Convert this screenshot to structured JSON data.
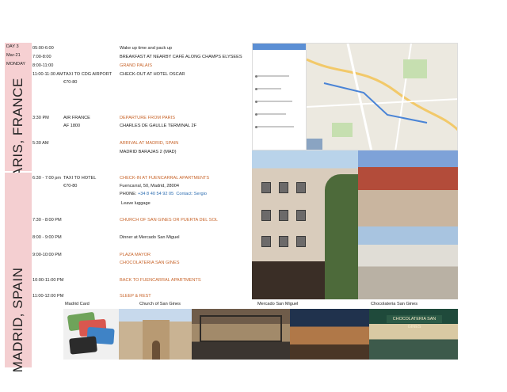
{
  "sections": {
    "paris": "PARIS, FRANCE",
    "madrid": "MADRID, SPAIN"
  },
  "day": {
    "label": "DAY 3",
    "date": "Mar-21",
    "weekday": "MONDAY"
  },
  "itinerary": [
    {
      "time": "05:00-6:00",
      "transport": "",
      "activity": "Wake up time and pack up",
      "style": ""
    },
    {
      "time": "7:00-8:00",
      "transport": "",
      "activity": "BREAKFAST AT NEARBY CAFÉ ALONG CHAMPS ELYSEES",
      "style": ""
    },
    {
      "time": "8:00-11:00",
      "transport": "",
      "activity": "GRAND PALAIS",
      "style": "orange"
    },
    {
      "time": "11:00-11:30 AM",
      "transport": "TAXI TO CDG AIRPORT",
      "activity": "CHECK-OUT AT HOTEL OSCAR",
      "style": ""
    },
    {
      "time": "",
      "transport": "€70-80",
      "activity": "",
      "style": ""
    },
    {
      "time": "3:30 PM",
      "transport": "AIR FRANCE",
      "activity": "DEPARTURE FROM PARIS",
      "style": "orange"
    },
    {
      "time": "",
      "transport": "AF 1800",
      "activity": "CHARLES DE GAULLE TERMINAL 2F",
      "style": ""
    },
    {
      "time": "5:30 AM",
      "transport": "",
      "activity": "ARRIVAL AT MADRID, SPAIN",
      "style": "orange"
    },
    {
      "time": "",
      "transport": "",
      "activity": "MADRID BARAJAS 2  (MAD)",
      "style": ""
    },
    {
      "time": "6:30 - 7:00 pm",
      "transport": "TAXI TO HOTEL",
      "activity": "CHECK-IN AT FUENCARRAL APARTMENTS",
      "style": "orange"
    },
    {
      "time": "",
      "transport": "€70-80",
      "activity": "Fuencarral, 50, Madrid, 28004",
      "style": ""
    },
    {
      "time": "",
      "transport": "",
      "activity": "PHONE: ",
      "style": ""
    },
    {
      "time": "",
      "transport": "",
      "activity": "Leave luggage",
      "style": ""
    },
    {
      "time": "7:30 - 8:00 PM",
      "transport": "",
      "activity": "CHURCH OF SAN GINES OR PUERTA DEL SOL",
      "style": "orange"
    },
    {
      "time": "8:00 - 9:00 PM",
      "transport": "",
      "activity": "Dinner at Mercado San Miguel",
      "style": ""
    },
    {
      "time": "9:00-10:00 PM",
      "transport": "",
      "activity": "PLAZA MAYOR",
      "style": "orange"
    },
    {
      "time": "",
      "transport": "",
      "activity": "CHOCOLATERIA  SAN GINES",
      "style": "orange"
    },
    {
      "time": "10:00-11:00 PM",
      "transport": "",
      "activity": "BACK TO FUENCARRAL APARTMENTS",
      "style": "orange"
    },
    {
      "time": "11:00-12:00 PM",
      "transport": "",
      "activity": "SLEEP & REST",
      "style": "orange"
    }
  ],
  "phone": {
    "number": "+34 8 40 54 92 05",
    "contact": "Contact: Sergio"
  },
  "captions": {
    "madrid_card": "Madrid Card",
    "church": "Church of San Gines",
    "mercado": "Mercado San Miguel",
    "chocolateria": "Chocolateria San Gines"
  },
  "signs": {
    "chocolateria_sign": "CHOCOLATERIA SAN GINES"
  },
  "colors": {
    "side_strip": "#f6d0d2",
    "accent_orange": "#c8652b",
    "link_blue": "#2b6cb0"
  }
}
